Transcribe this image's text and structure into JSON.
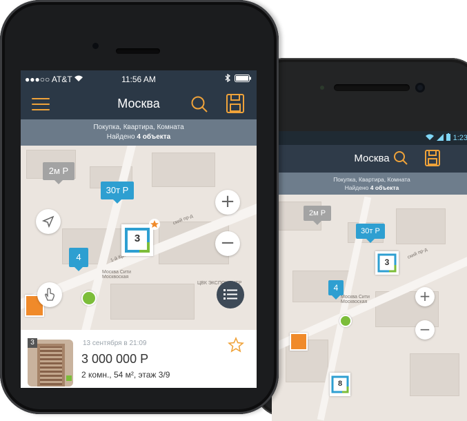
{
  "android": {
    "status_time": "1:23",
    "title": "Москва",
    "filter_line1": "Покупка, Квартира, Комната",
    "filter_found_prefix": "Найдено",
    "filter_found_count": "4 объекта",
    "map": {
      "pin_2m": "2м Р",
      "pin_30t": "30т Р",
      "pin_4": "4",
      "logo_3": "3",
      "logo_8": "8",
      "place_label": "Москва Сити Москвоская",
      "street_label": "ский пр-д"
    }
  },
  "iphone": {
    "carrier": "●●●○○ AT&T",
    "time": "11:56 AM",
    "title": "Москва",
    "filter_line1": "Покупка, Квартира, Комната",
    "filter_found_prefix": "Найдено",
    "filter_found_count": "4 объекта",
    "map": {
      "pin_2m": "2м Р",
      "pin_30t": "30т Р",
      "pin_4": "4",
      "logo_3": "3",
      "street_label": "ский пр-д",
      "street_label2": "1-й Кр",
      "place_label": "Москва Сити Москвоская",
      "business_label": "ЦВК ЭКСПОЦЕНТР",
      "zoom_in": "+",
      "zoom_out": "−"
    },
    "listing": {
      "badge": "3",
      "date": "13 сентября в 21:09",
      "price": "3 000 000 Р",
      "details": "2 комн., 54 м², этаж 3/9"
    }
  },
  "colors": {
    "appbar": "#2b3846",
    "filterbar": "#6b7a89",
    "accent": "#f0a33a",
    "pin": "#2e9fd1",
    "green": "#7cbd3a"
  }
}
